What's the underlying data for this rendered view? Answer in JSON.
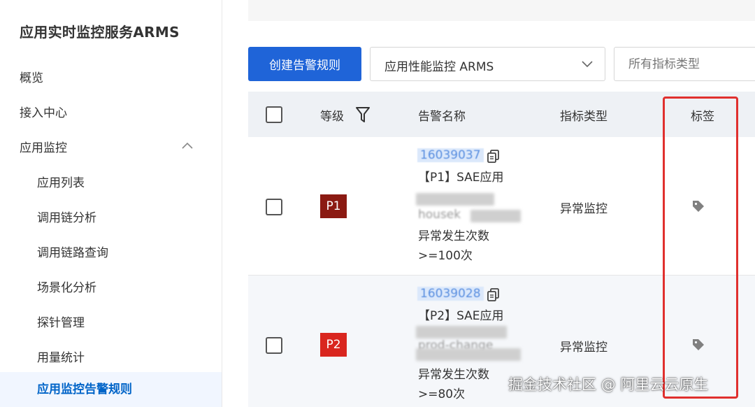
{
  "sidebar": {
    "title": "应用实时监控服务ARMS",
    "items": [
      {
        "label": "概览"
      },
      {
        "label": "接入中心"
      },
      {
        "label": "应用监控"
      }
    ],
    "subitems": [
      {
        "label": "应用列表"
      },
      {
        "label": "调用链分析"
      },
      {
        "label": "调用链路查询"
      },
      {
        "label": "场景化分析"
      },
      {
        "label": "探针管理"
      },
      {
        "label": "用量统计"
      },
      {
        "label": "应用监控告警规则"
      }
    ],
    "active_item": "应用监控告警规则"
  },
  "toolbar": {
    "create_label": "创建告警规则",
    "product_select": "应用性能监控 ARMS",
    "metric_type_placeholder": "所有指标类型"
  },
  "table": {
    "headers": {
      "level": "等级",
      "name": "告警名称",
      "metric_type": "指标类型",
      "tags": "标签"
    },
    "rows": [
      {
        "level": "P1",
        "level_color": "#8b1a12",
        "id": "16039037",
        "name": "【P1】SAE应用",
        "blurred_line": "housek",
        "condition": "异常发生次数",
        "threshold": ">=100次",
        "metric_type": "异常监控"
      },
      {
        "level": "P2",
        "level_color": "#d9261f",
        "id": "16039028",
        "name": "【P2】SAE应用",
        "blurred_line": "prod-change",
        "condition": "异常发生次数",
        "threshold": ">=80次",
        "metric_type": "异常监控"
      }
    ]
  },
  "annotation_color": "#e0302e",
  "watermark": "掘金技术社区 @ 阿里云云原生"
}
